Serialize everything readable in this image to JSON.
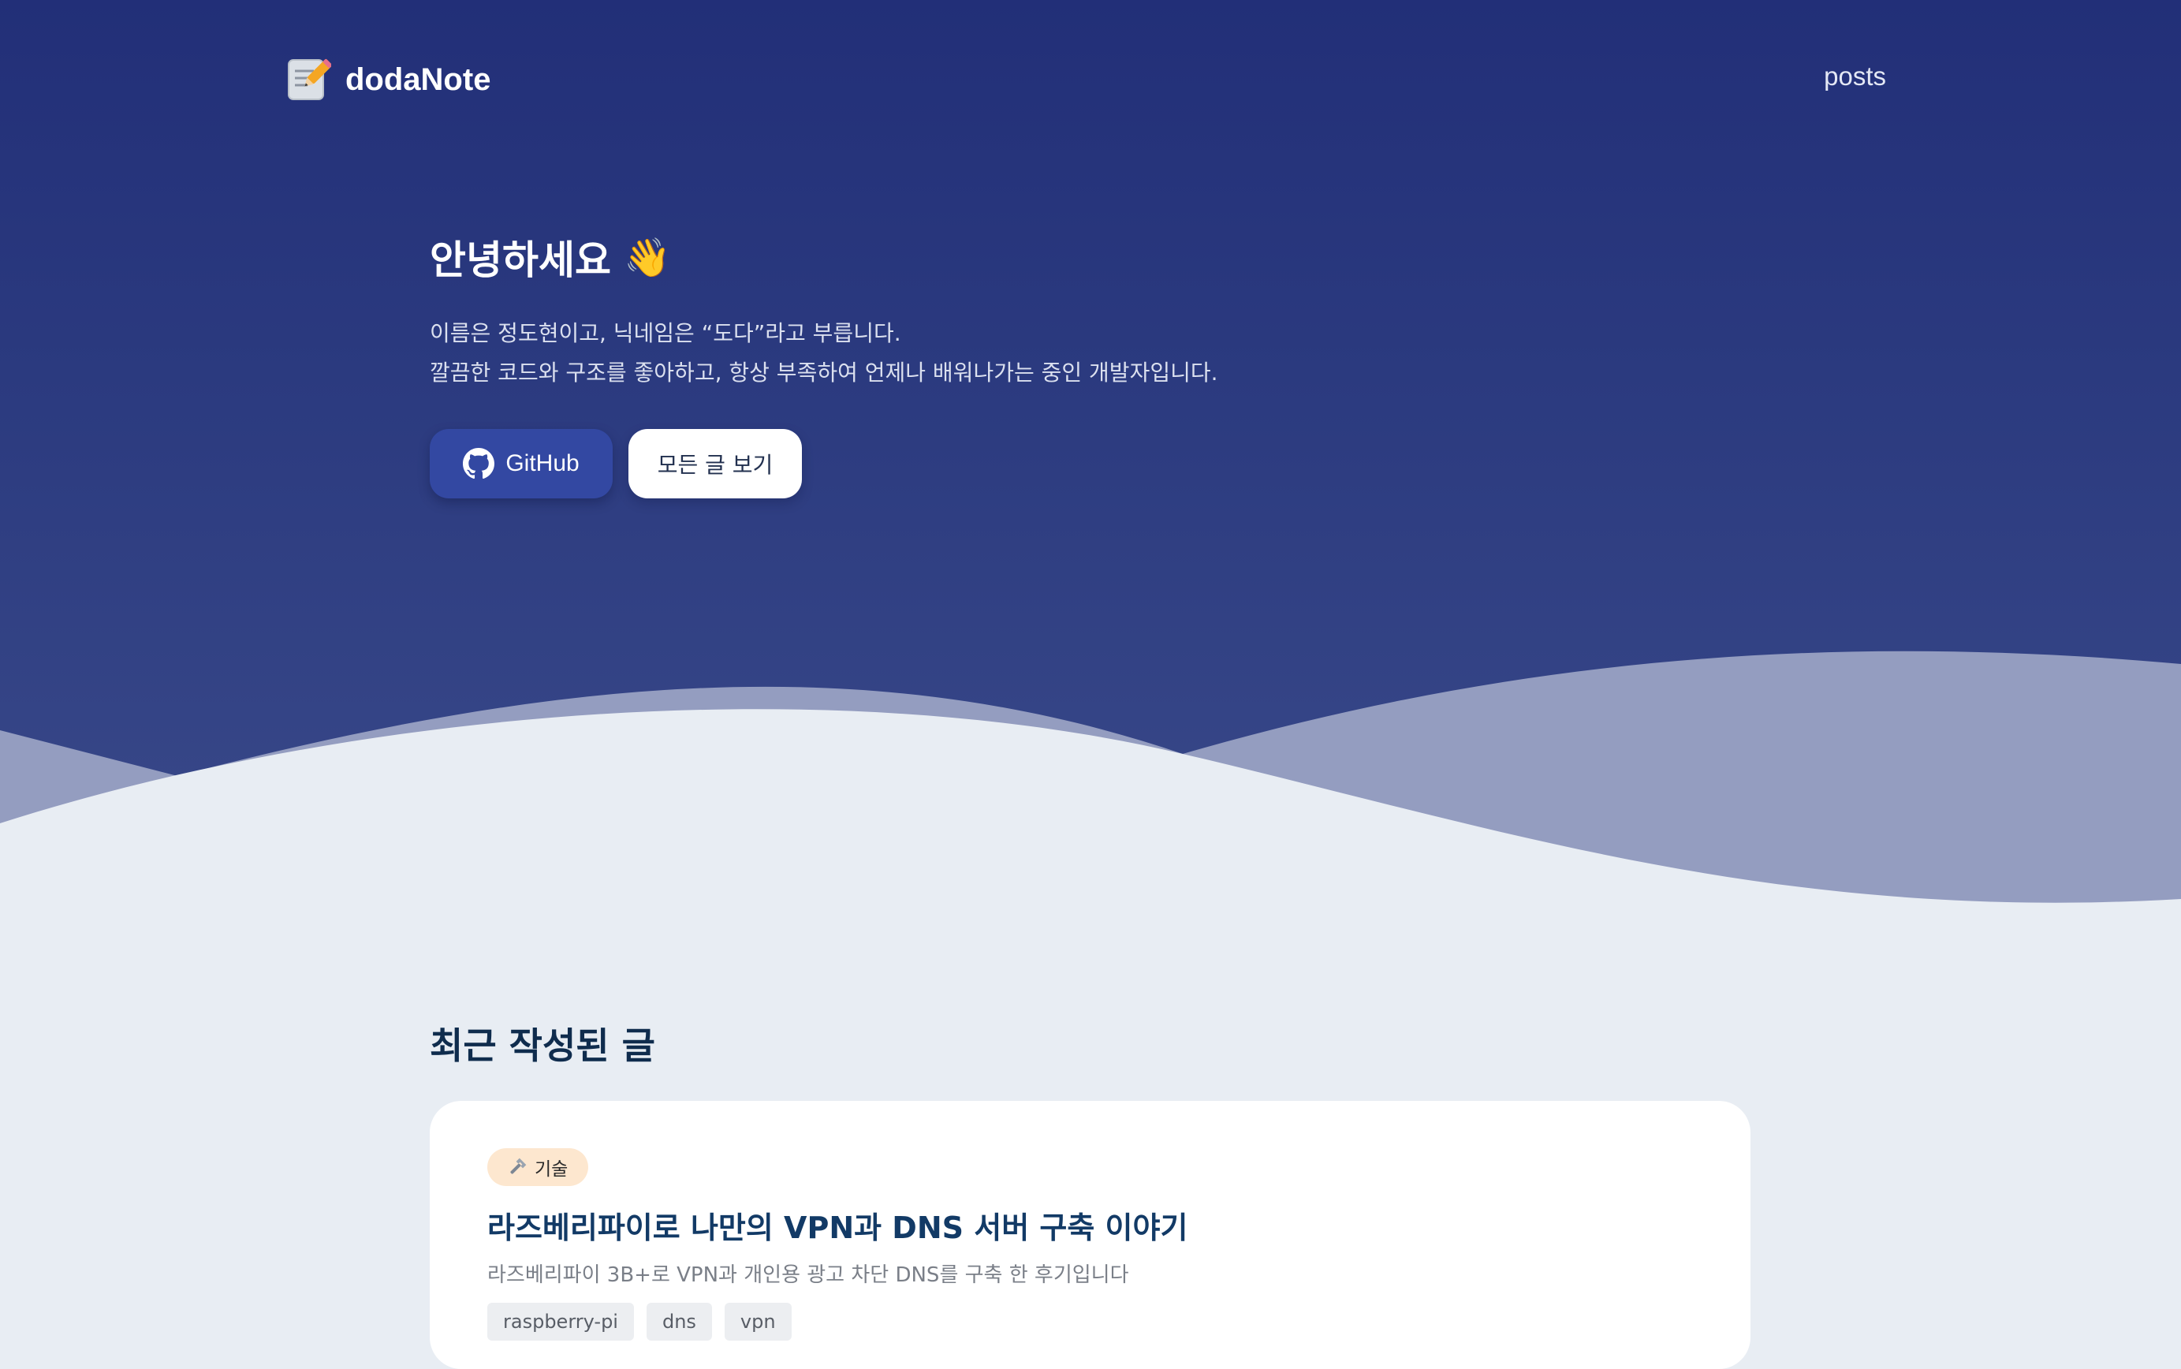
{
  "header": {
    "brand": "dodaNote",
    "brand_icon": "memo-icon",
    "nav": {
      "posts_label": "posts"
    }
  },
  "hero": {
    "greeting": "안녕하세요",
    "greeting_emoji": "👋",
    "intro_line1": "이름은 정도현이고, 닉네임은 “도다”라고 부릅니다.",
    "intro_line2": "깔끔한 코드와 구조를 좋아하고, 항상 부족하여 언제나 배워나가는 중인 개발자입니다.",
    "github_button": "GitHub",
    "github_icon": "github-icon",
    "all_posts_button": "모든 글 보기"
  },
  "recent": {
    "title": "최근 작성된 글",
    "posts": [
      {
        "category_icon": "wrench-icon",
        "category": "기술",
        "title": "라즈베리파이로 나만의 VPN과 DNS 서버 구축 이야기",
        "description": "라즈베리파이 3B+로 VPN과 개인용 광고 차단 DNS를 구축 한 후기입니다",
        "tags": [
          "raspberry-pi",
          "dns",
          "vpn"
        ]
      }
    ]
  },
  "colors": {
    "hero_top": "#222f78",
    "hero_bottom": "#3a4a8a",
    "wave_back": "#949dc0",
    "page_bg": "#e8edf3",
    "github_button_bg": "#3348a2",
    "section_title": "#0f2c4d",
    "post_title": "#123a66",
    "category_bg": "#fde7cf"
  }
}
